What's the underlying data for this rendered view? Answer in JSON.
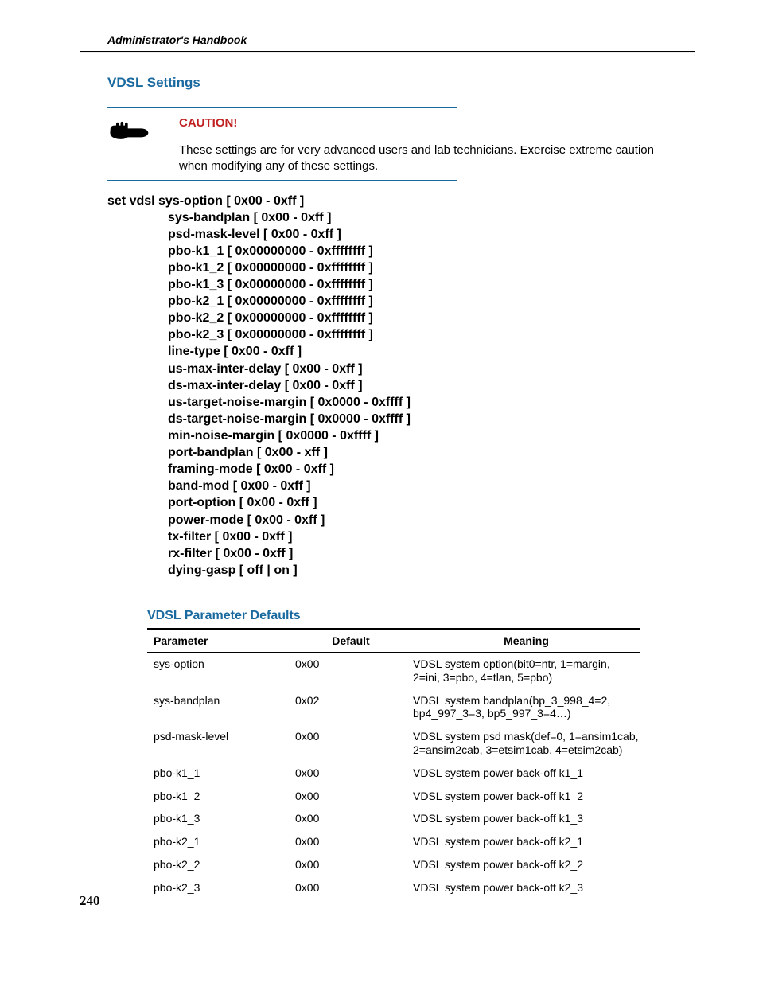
{
  "running_head": "Administrator's Handbook",
  "section_title": "VDSL Settings",
  "caution": {
    "label": "CAUTION!",
    "body": "These settings are for very advanced users and lab technicians. Exercise extreme caution when modifying any of these settings."
  },
  "cmd": {
    "first": "set vdsl sys-option [ 0x00 - 0xff ]",
    "lines": [
      "sys-bandplan [ 0x00 - 0xff ]",
      "psd-mask-level [ 0x00 - 0xff ]",
      "pbo-k1_1 [ 0x00000000 - 0xffffffff ]",
      "pbo-k1_2 [ 0x00000000 - 0xffffffff ]",
      "pbo-k1_3 [ 0x00000000 - 0xffffffff ]",
      "pbo-k2_1 [ 0x00000000 - 0xffffffff ]",
      "pbo-k2_2 [ 0x00000000 - 0xffffffff ]",
      "pbo-k2_3 [ 0x00000000 - 0xffffffff ]",
      "line-type [ 0x00 - 0xff ]",
      "us-max-inter-delay [ 0x00 - 0xff ]",
      "ds-max-inter-delay [ 0x00 - 0xff ]",
      "us-target-noise-margin [ 0x0000 - 0xffff ]",
      "ds-target-noise-margin [ 0x0000 - 0xffff ]",
      "min-noise-margin [ 0x0000 - 0xffff ]",
      "port-bandplan [ 0x00 - xff ]",
      "framing-mode [ 0x00 - 0xff ]",
      "band-mod [ 0x00 - 0xff ]",
      "port-option [ 0x00 - 0xff ]",
      "power-mode [ 0x00 - 0xff ]",
      "tx-filter [ 0x00 - 0xff ]",
      "rx-filter [ 0x00 - 0xff ]",
      "dying-gasp [ off | on ]"
    ]
  },
  "table": {
    "title": "VDSL Parameter Defaults",
    "headers": {
      "param": "Parameter",
      "default": "Default",
      "meaning": "Meaning"
    },
    "rows": [
      {
        "param": "sys-option",
        "default": "0x00",
        "meaning": "VDSL system option(bit0=ntr, 1=margin, 2=ini, 3=pbo, 4=tlan, 5=pbo)"
      },
      {
        "param": "sys-bandplan",
        "default": "0x02",
        "meaning": "VDSL system bandplan(bp_3_998_4=2, bp4_997_3=3, bp5_997_3=4…)"
      },
      {
        "param": "psd-mask-level",
        "default": "0x00",
        "meaning": "VDSL system psd mask(def=0, 1=ansim1cab, 2=ansim2cab, 3=etsim1cab, 4=etsim2cab)"
      },
      {
        "param": "pbo-k1_1",
        "default": "0x00",
        "meaning": "VDSL system power back-off k1_1"
      },
      {
        "param": "pbo-k1_2",
        "default": "0x00",
        "meaning": "VDSL system power back-off k1_2"
      },
      {
        "param": "pbo-k1_3",
        "default": "0x00",
        "meaning": "VDSL system power back-off k1_3"
      },
      {
        "param": "pbo-k2_1",
        "default": "0x00",
        "meaning": "VDSL system power back-off k2_1"
      },
      {
        "param": "pbo-k2_2",
        "default": "0x00",
        "meaning": "VDSL system power back-off k2_2"
      },
      {
        "param": "pbo-k2_3",
        "default": "0x00",
        "meaning": "VDSL system power back-off k2_3"
      }
    ]
  },
  "page_number": "240"
}
